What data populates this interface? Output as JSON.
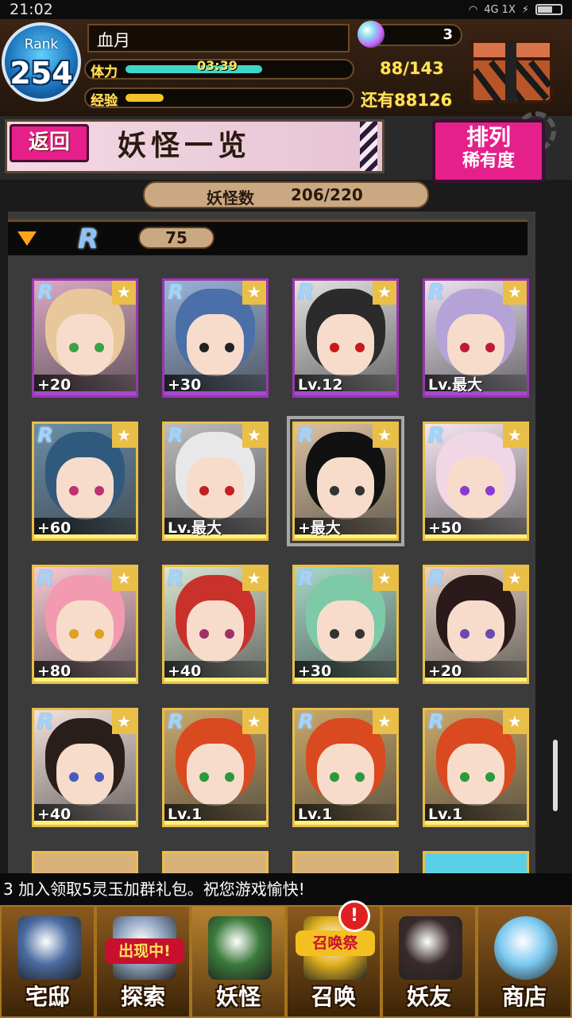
{
  "statusbar": {
    "time": "21:02",
    "network": "4G 1X"
  },
  "header": {
    "rank_label": "Rank",
    "rank_value": "254",
    "player_name": "血月",
    "stamina_label": "体力",
    "stamina_timer": "03:39",
    "stamina_value": "88/143",
    "stamina_fraction": 0.615,
    "exp_label": "经验",
    "exp_remaining": "还有88126",
    "exp_fraction": 0.17,
    "orb_count": "3"
  },
  "titlebar": {
    "back_label": "返回",
    "page_title": "妖怪一览",
    "sort_label": "排列",
    "sort_value": "稀有度"
  },
  "count": {
    "label": "妖怪数",
    "value": "206/220"
  },
  "rarity_group": {
    "badge": "R",
    "count": "75"
  },
  "cards": [
    {
      "level": "+20",
      "frame": "purple",
      "hair": "#e8c79a",
      "eyes": "#3aa24a",
      "bg": "#d9a9c4"
    },
    {
      "level": "+30",
      "frame": "purple",
      "hair": "#4b6fa8",
      "eyes": "#222",
      "bg": "#9ab2d8"
    },
    {
      "level": "Lv.12",
      "frame": "purple",
      "hair": "#2b2b2b",
      "eyes": "#c81a1a",
      "bg": "#e2e2e2"
    },
    {
      "level": "Lv.最大",
      "frame": "purple",
      "hair": "#b5a3d8",
      "eyes": "#c01a3a",
      "bg": "#ebe2f0"
    },
    {
      "level": "+60",
      "frame": "gold",
      "hair": "#2f5a7e",
      "eyes": "#c03070",
      "bg": "#6a8ea8"
    },
    {
      "level": "Lv.最大",
      "frame": "gold",
      "hair": "#e8e8e8",
      "eyes": "#c02020",
      "bg": "#bdbdbd"
    },
    {
      "level": "+最大",
      "frame": "gold",
      "hair": "#111111",
      "eyes": "#333",
      "bg": "#dcc2a0",
      "selected": true
    },
    {
      "level": "+50",
      "frame": "gold",
      "hair": "#f1d6e6",
      "eyes": "#8a3ad0",
      "bg": "#f6e8f2"
    },
    {
      "level": "+80",
      "frame": "gold",
      "hair": "#f29ab0",
      "eyes": "#e0a020",
      "bg": "#f7c9d4"
    },
    {
      "level": "+40",
      "frame": "gold",
      "hair": "#c8322a",
      "eyes": "#a0306a",
      "bg": "#d9e6d2"
    },
    {
      "level": "+30",
      "frame": "gold",
      "hair": "#7ec9a8",
      "eyes": "#333",
      "bg": "#a8d8c8"
    },
    {
      "level": "+20",
      "frame": "gold",
      "hair": "#2a1a1a",
      "eyes": "#6a4ab0",
      "bg": "#e8d2c4"
    },
    {
      "level": "+40",
      "frame": "gold",
      "hair": "#2a1e1a",
      "eyes": "#4a5ac0",
      "bg": "#f3e1dc"
    },
    {
      "level": "Lv.1",
      "frame": "gold",
      "hair": "#d94a20",
      "eyes": "#2a9a3a",
      "bg": "#c9a86a"
    },
    {
      "level": "Lv.1",
      "frame": "gold",
      "hair": "#d94a20",
      "eyes": "#2a9a3a",
      "bg": "#c9a86a"
    },
    {
      "level": "Lv.1",
      "frame": "gold",
      "hair": "#d94a20",
      "eyes": "#2a9a3a",
      "bg": "#c9a86a"
    }
  ],
  "ticker": "3 加入领取5灵玉加群礼包。祝您游戏愉快!",
  "nav": [
    {
      "label": "宅邸",
      "icon": "house-icon"
    },
    {
      "label": "探索",
      "icon": "globe-icon",
      "tag": "出现中!"
    },
    {
      "label": "妖怪",
      "icon": "scroll-icon"
    },
    {
      "label": "召唤",
      "icon": "star-icon",
      "tag": "召唤祭",
      "alert": "!"
    },
    {
      "label": "妖友",
      "icon": "friend-icon"
    },
    {
      "label": "商店",
      "icon": "crystal-ball-icon"
    }
  ],
  "colors": {
    "accent": "#e6208a",
    "gold": "#e9bf48",
    "purple": "#9a37b0",
    "stamina": "#3ed6c6",
    "exp": "#f3c42a"
  }
}
